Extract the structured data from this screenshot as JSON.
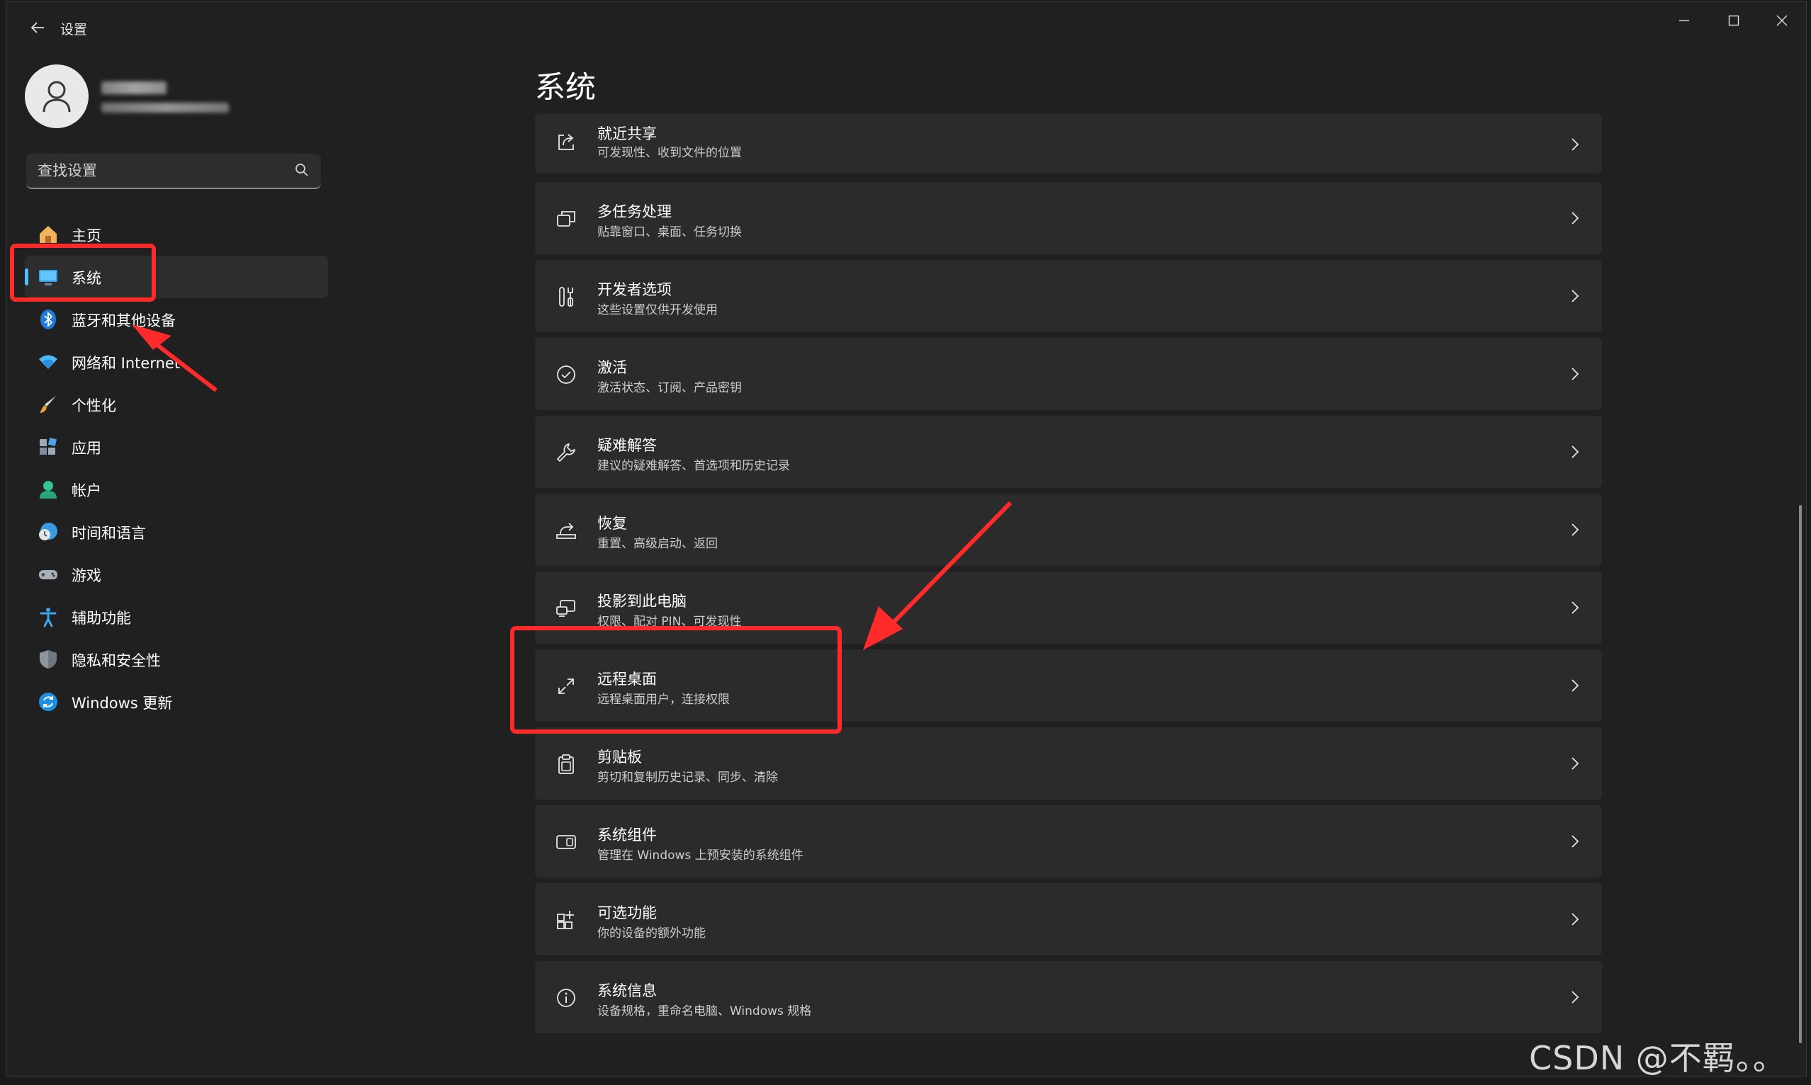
{
  "window": {
    "title": "设置",
    "controls": [
      "minimize-icon",
      "maximize-icon",
      "close-icon"
    ]
  },
  "search": {
    "placeholder": "查找设置"
  },
  "sidebar": {
    "items": [
      {
        "label": "主页",
        "icon": "home-icon",
        "selected": false
      },
      {
        "label": "系统",
        "icon": "system-display-icon",
        "selected": true
      },
      {
        "label": "蓝牙和其他设备",
        "icon": "bluetooth-icon",
        "selected": false
      },
      {
        "label": "网络和 Internet",
        "icon": "wifi-icon",
        "selected": false
      },
      {
        "label": "个性化",
        "icon": "brush-icon",
        "selected": false
      },
      {
        "label": "应用",
        "icon": "apps-icon",
        "selected": false
      },
      {
        "label": "帐户",
        "icon": "account-icon",
        "selected": false
      },
      {
        "label": "时间和语言",
        "icon": "time-language-icon",
        "selected": false
      },
      {
        "label": "游戏",
        "icon": "gamepad-icon",
        "selected": false
      },
      {
        "label": "辅助功能",
        "icon": "accessibility-icon",
        "selected": false
      },
      {
        "label": "隐私和安全性",
        "icon": "shield-icon",
        "selected": false
      },
      {
        "label": "Windows 更新",
        "icon": "windows-update-icon",
        "selected": false
      }
    ]
  },
  "main": {
    "title": "系统",
    "cards": [
      {
        "title": "就近共享",
        "subtitle": "可发现性、收到文件的位置",
        "icon": "nearby-share-icon"
      },
      {
        "title": "多任务处理",
        "subtitle": "贴靠窗口、桌面、任务切换",
        "icon": "multitasking-icon"
      },
      {
        "title": "开发者选项",
        "subtitle": "这些设置仅供开发使用",
        "icon": "developer-tools-icon"
      },
      {
        "title": "激活",
        "subtitle": "激活状态、订阅、产品密钥",
        "icon": "activation-check-icon"
      },
      {
        "title": "疑难解答",
        "subtitle": "建议的疑难解答、首选项和历史记录",
        "icon": "wrench-icon"
      },
      {
        "title": "恢复",
        "subtitle": "重置、高级启动、返回",
        "icon": "recovery-icon"
      },
      {
        "title": "投影到此电脑",
        "subtitle": "权限、配对 PIN、可发现性",
        "icon": "project-to-pc-icon"
      },
      {
        "title": "远程桌面",
        "subtitle": "远程桌面用户，连接权限",
        "icon": "remote-desktop-icon"
      },
      {
        "title": "剪贴板",
        "subtitle": "剪切和复制历史记录、同步、清除",
        "icon": "clipboard-icon"
      },
      {
        "title": "系统组件",
        "subtitle": "管理在 Windows 上预安装的系统组件",
        "icon": "system-components-icon"
      },
      {
        "title": "可选功能",
        "subtitle": "你的设备的额外功能",
        "icon": "optional-features-icon"
      },
      {
        "title": "系统信息",
        "subtitle": "设备规格，重命名电脑、Windows 规格",
        "icon": "info-icon"
      }
    ]
  },
  "watermark": "CSDN @不羁。。",
  "colors": {
    "window_bg": "#202020",
    "card_bg": "#2b2b2b",
    "accent": "#4cc2ff",
    "annotation": "#ff2b2b"
  }
}
